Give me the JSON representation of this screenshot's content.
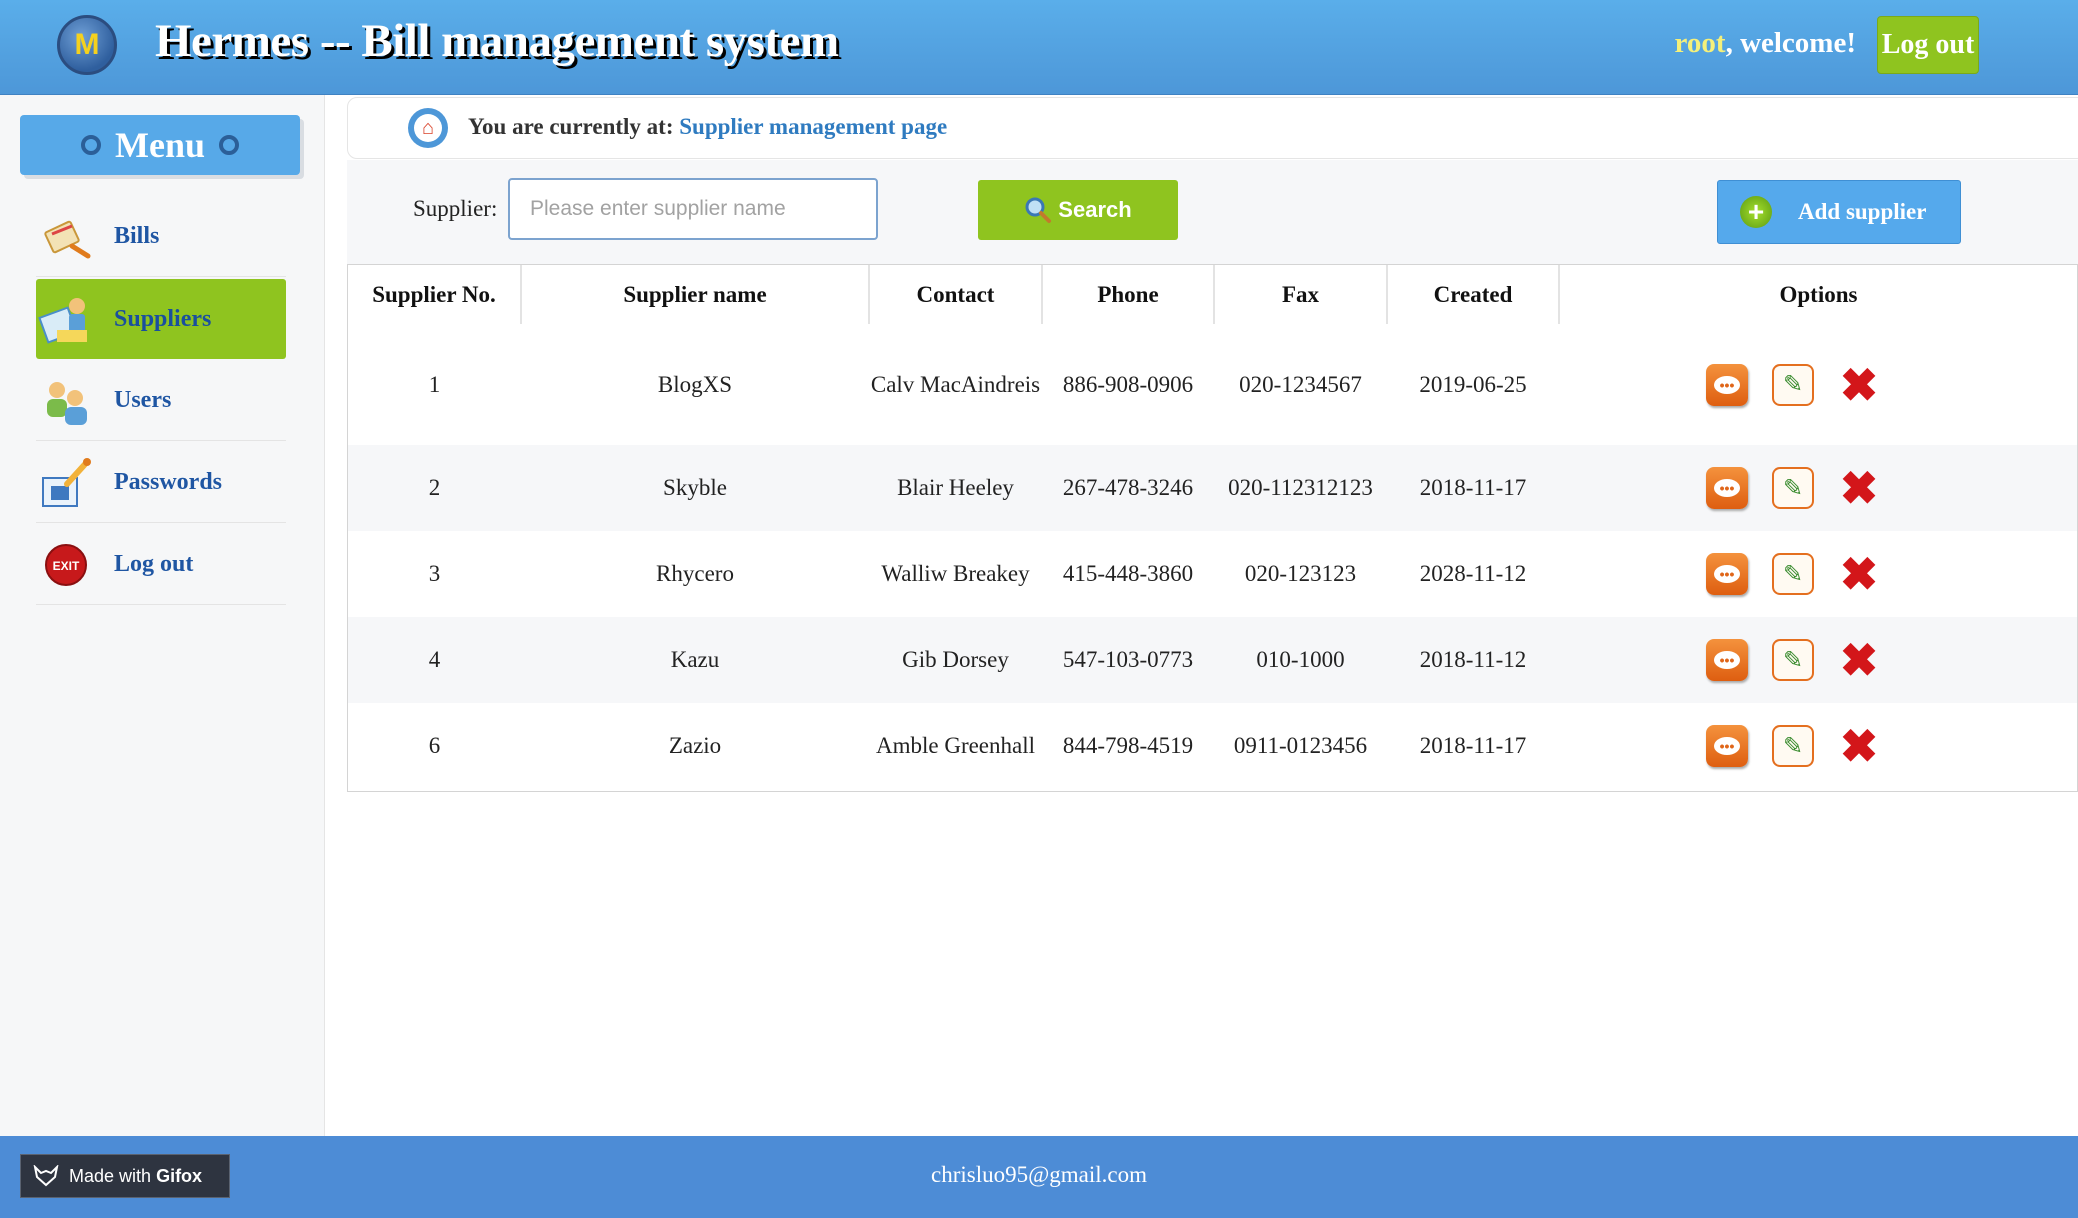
{
  "header": {
    "logo_letter": "M",
    "title": "Hermes -- Bill management system",
    "user": "root",
    "welcome_suffix": ", welcome!",
    "logout_label": "Log out"
  },
  "sidebar": {
    "menu_title": "Menu",
    "items": [
      {
        "label": "Bills",
        "icon": "bills-icon",
        "active": false
      },
      {
        "label": "Suppliers",
        "icon": "suppliers-icon",
        "active": true
      },
      {
        "label": "Users",
        "icon": "users-icon",
        "active": false
      },
      {
        "label": "Passwords",
        "icon": "passwords-icon",
        "active": false
      },
      {
        "label": "Log out",
        "icon": "exit-icon",
        "active": false
      }
    ]
  },
  "breadcrumb": {
    "prefix": "You are currently at:",
    "page": "Supplier management page"
  },
  "search": {
    "label": "Supplier:",
    "placeholder": "Please enter supplier name",
    "value": "",
    "button_label": "Search",
    "add_label": "Add supplier"
  },
  "table": {
    "columns": [
      "Supplier No.",
      "Supplier name",
      "Contact",
      "Phone",
      "Fax",
      "Created",
      "Options"
    ],
    "rows": [
      {
        "no": "1",
        "name": "BlogXS",
        "contact": "Calv MacAindreis",
        "phone": "886-908-0906",
        "fax": "020-1234567",
        "created": "2019-06-25"
      },
      {
        "no": "2",
        "name": "Skyble",
        "contact": "Blair Heeley",
        "phone": "267-478-3246",
        "fax": "020-112312123",
        "created": "2018-11-17"
      },
      {
        "no": "3",
        "name": "Rhycero",
        "contact": "Walliw Breakey",
        "phone": "415-448-3860",
        "fax": "020-123123",
        "created": "2028-11-12"
      },
      {
        "no": "4",
        "name": "Kazu",
        "contact": "Gib Dorsey",
        "phone": "547-103-0773",
        "fax": "010-1000",
        "created": "2018-11-12"
      },
      {
        "no": "6",
        "name": "Zazio",
        "contact": "Amble Greenhall",
        "phone": "844-798-4519",
        "fax": "0911-0123456",
        "created": "2018-11-17"
      }
    ]
  },
  "footer": {
    "email": "chrisluo95@gmail.com",
    "badge_prefix": "Made with",
    "badge_brand": "Gifox"
  },
  "colors": {
    "header_blue": "#5aaeea",
    "accent_green": "#8fc41f",
    "link_blue": "#2f7bc0",
    "delete_red": "#d3161a"
  }
}
